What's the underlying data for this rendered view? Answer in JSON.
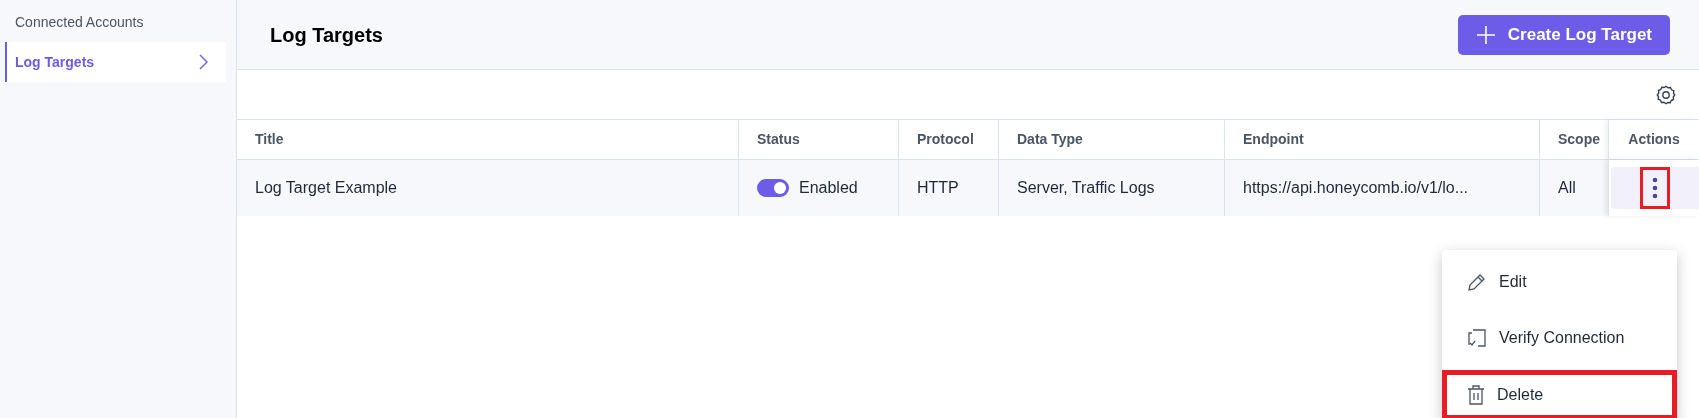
{
  "sidebar": {
    "items": [
      {
        "label": "Connected Accounts",
        "selected": false
      },
      {
        "label": "Log Targets",
        "selected": true
      }
    ]
  },
  "header": {
    "title": "Log Targets",
    "create_button": "Create Log Target"
  },
  "table": {
    "columns": [
      "Title",
      "Status",
      "Protocol",
      "Data Type",
      "Endpoint",
      "Scope",
      "Actions"
    ],
    "rows": [
      {
        "title": "Log Target Example",
        "status": {
          "label": "Enabled",
          "on": true
        },
        "protocol": "HTTP",
        "data_type": "Server, Traffic Logs",
        "endpoint": "https://api.honeycomb.io/v1/lo...",
        "scope": "All",
        "actions_highlighted": true
      }
    ]
  },
  "actions_menu": {
    "items": [
      {
        "label": "Edit",
        "kind": "edit",
        "highlighted": false
      },
      {
        "label": "Verify Connection",
        "kind": "verify",
        "highlighted": false
      },
      {
        "label": "Delete",
        "kind": "delete",
        "highlighted": true
      }
    ]
  }
}
